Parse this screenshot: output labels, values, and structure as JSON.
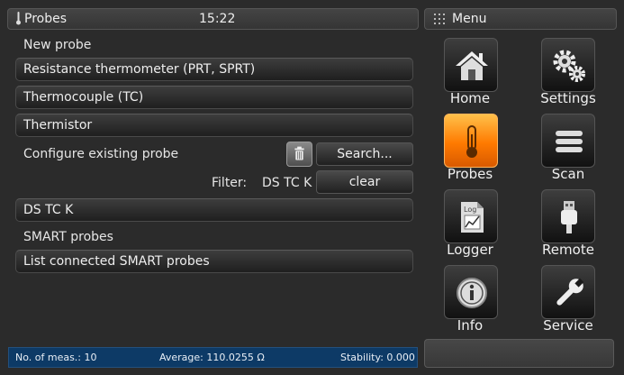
{
  "header": {
    "title": "Probes",
    "time": "15:22"
  },
  "menu": {
    "title": "Menu"
  },
  "sections": {
    "new_probe": "New probe",
    "configure": "Configure existing probe",
    "smart": "SMART probes"
  },
  "probe_types": [
    "Resistance thermometer (PRT, SPRT)",
    "Thermocouple (TC)",
    "Thermistor"
  ],
  "search_label": "Search...",
  "filter": {
    "label": "Filter:",
    "value": "DS TC K",
    "clear_label": "clear"
  },
  "existing_probe": "DS TC K",
  "smart_button": "List connected SMART probes",
  "tiles": [
    {
      "label": "Home",
      "icon": "home-icon"
    },
    {
      "label": "Settings",
      "icon": "gears-icon"
    },
    {
      "label": "Probes",
      "icon": "thermometer-icon",
      "active": true
    },
    {
      "label": "Scan",
      "icon": "list-icon"
    },
    {
      "label": "Logger",
      "icon": "logger-icon"
    },
    {
      "label": "Remote",
      "icon": "usb-icon"
    },
    {
      "label": "Info",
      "icon": "info-icon"
    },
    {
      "label": "Service",
      "icon": "wrench-icon"
    }
  ],
  "status": {
    "measurements": "No. of meas.: 10",
    "average": "Average: 110.0255 Ω",
    "stability": "Stability: 0.000"
  },
  "colors": {
    "accent": "#ff8a00",
    "status_bar": "#0d3a66",
    "background": "#2b2b2b"
  }
}
